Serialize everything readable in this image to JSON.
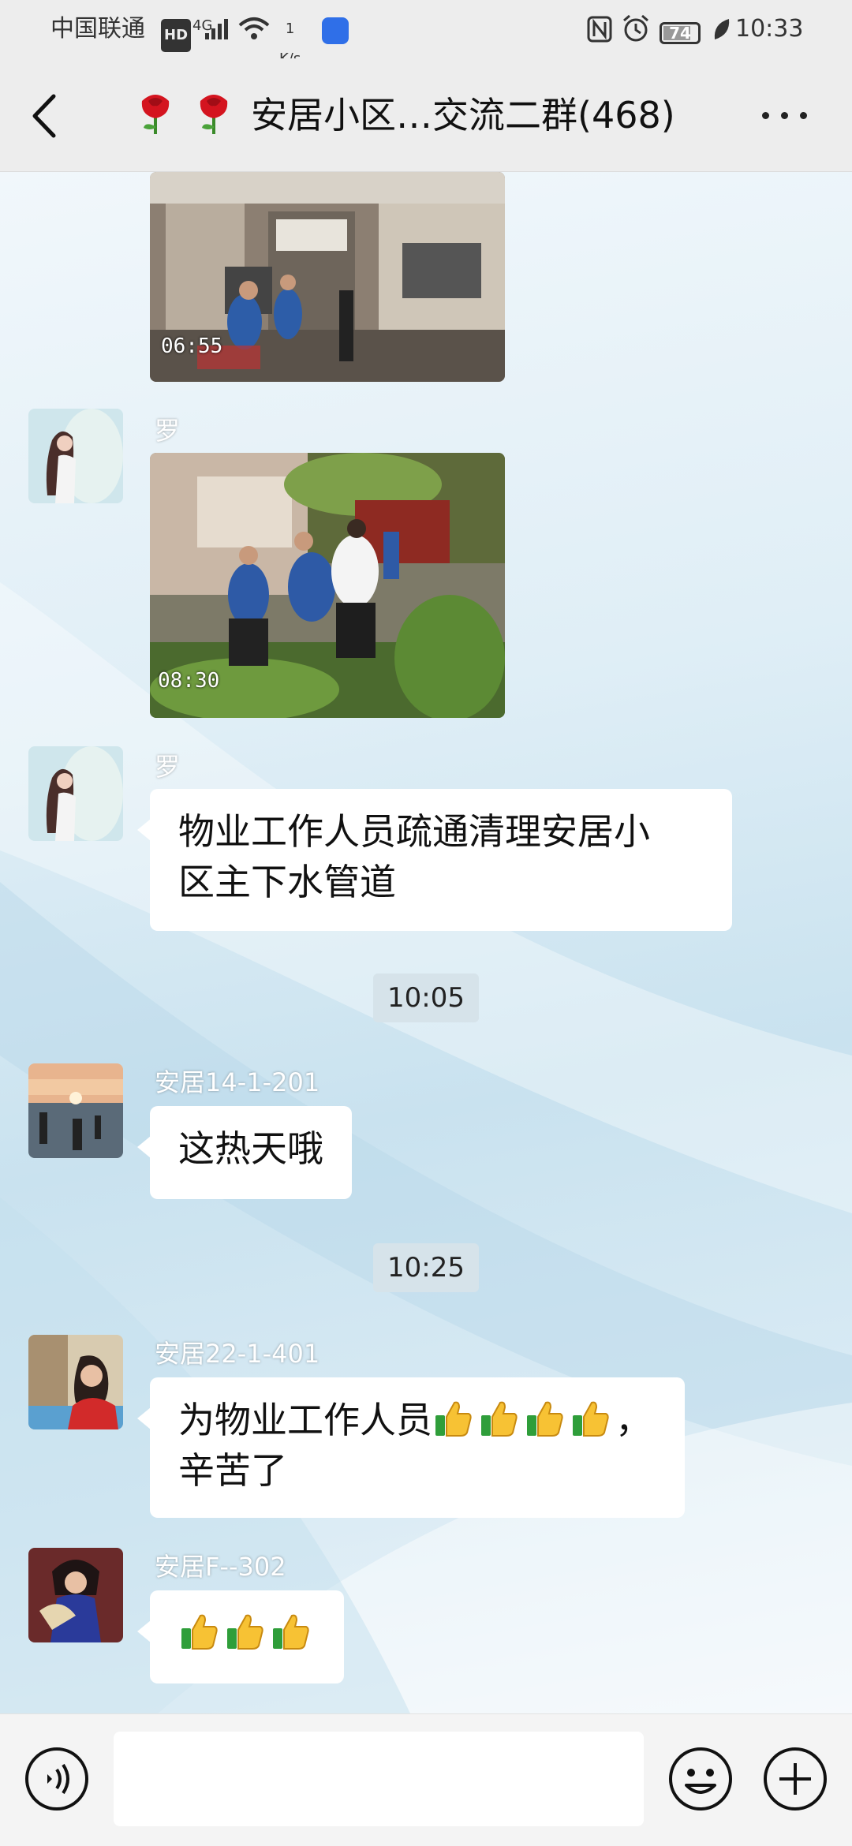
{
  "status_bar": {
    "carrier": "中国联通",
    "hd": "HD",
    "signal": "4G",
    "net_speed_value": "1",
    "net_speed_unit": "K/s",
    "battery": "74",
    "time": "10:33"
  },
  "header": {
    "title": "安居小区…交流二群(468)"
  },
  "messages": [
    {
      "type": "image",
      "sender": "",
      "overlay": "06:55"
    },
    {
      "type": "image",
      "sender": "罗",
      "overlay": "08:30"
    },
    {
      "type": "text",
      "sender": "罗",
      "text_line1": "物业工作人员疏通清理安居小",
      "text_line2": "区主下水管道"
    },
    {
      "type": "time",
      "text": "10:05"
    },
    {
      "type": "text",
      "sender": "安居14-1-201",
      "text": "这热天哦"
    },
    {
      "type": "time",
      "text": "10:25"
    },
    {
      "type": "text",
      "sender": "安居22-1-401",
      "text_line1": "为物业工作人员",
      "text_line1_tail": "，",
      "text_line2": "辛苦了",
      "emoji_count": 4
    },
    {
      "type": "text",
      "sender": "安居F--302",
      "emoji_count": 3
    }
  ],
  "input": {
    "placeholder": ""
  },
  "icons": [
    "back-icon",
    "rose-icon",
    "more-icon",
    "voice-icon",
    "emoji-icon",
    "plus-icon",
    "thumbs-up-icon"
  ],
  "colors": {
    "bubble": "#ffffff",
    "bar": "#ededed",
    "timestamp_bg": "#d6e3ea"
  }
}
